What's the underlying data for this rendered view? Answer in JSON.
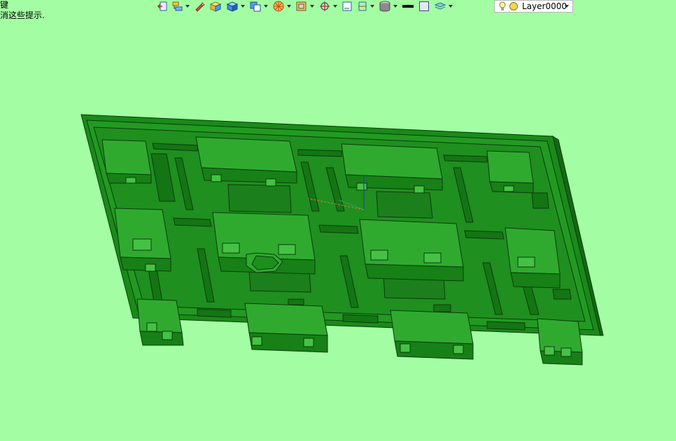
{
  "status_hints": {
    "line1": "键",
    "line2": "消这些提示."
  },
  "toolbar": {
    "buttons": [
      {
        "icon": "exit-icon",
        "dropdown": false
      },
      {
        "icon": "layer-tree-icon",
        "dropdown": true
      },
      {
        "icon": "pencil-icon",
        "dropdown": false
      },
      {
        "icon": "solid-box-icon",
        "dropdown": false
      },
      {
        "icon": "cube-icon",
        "dropdown": true
      },
      {
        "icon": "view-cube-icon",
        "dropdown": true
      },
      {
        "icon": "section-wheel-icon",
        "dropdown": true
      },
      {
        "icon": "frame-icon",
        "dropdown": true
      },
      {
        "icon": "crosshair-icon",
        "dropdown": true
      },
      {
        "icon": "sketch-icon",
        "dropdown": false
      },
      {
        "icon": "bracket-icon",
        "dropdown": true
      },
      {
        "icon": "cylinder-icon",
        "dropdown": true
      },
      {
        "icon": "line-color-icon",
        "dropdown": false
      },
      {
        "icon": "fill-color-icon",
        "dropdown": false
      },
      {
        "icon": "layers-icon",
        "dropdown": true
      }
    ]
  },
  "layer_selector": {
    "value": "Layer0000"
  },
  "colors": {
    "background": "#a3fea3",
    "model_base": "#1f8f1f",
    "model_light": "#2fa82f",
    "model_dark": "#156b15",
    "model_edge": "#0a3d0a"
  },
  "viewport": {
    "model_name": "tray-model"
  }
}
